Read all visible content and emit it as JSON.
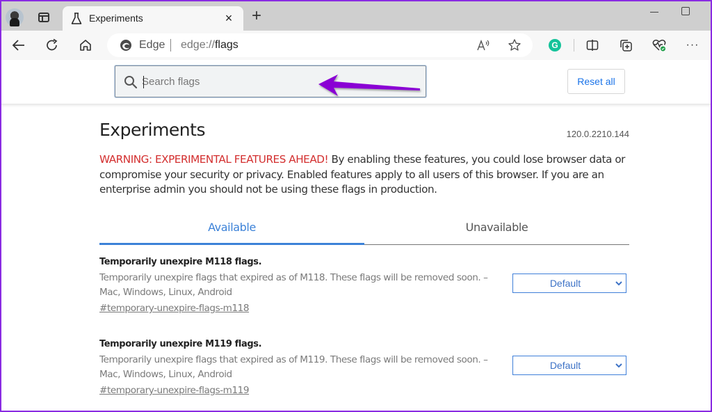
{
  "browser": {
    "tab": {
      "title": "Experiments",
      "icon": "flask-icon",
      "close_label": "×"
    },
    "new_tab_label": "+",
    "address_bar": {
      "brand": "Edge",
      "url_prefix": "edge://",
      "url_path": "flags"
    },
    "toolbar_icons": [
      "back-icon",
      "refresh-icon",
      "home-icon",
      "read-aloud-icon",
      "favorite-star-icon",
      "grammarly-icon",
      "split-screen-icon",
      "collections-icon",
      "browser-essentials-icon",
      "more-menu-icon"
    ],
    "grammarly_glyph": "G",
    "more_label": "···"
  },
  "flags_header": {
    "search": {
      "placeholder": "Search flags",
      "value": ""
    },
    "reset_label": "Reset all"
  },
  "page": {
    "title": "Experiments",
    "version": "120.0.2210.144",
    "warning_label": "WARNING: EXPERIMENTAL FEATURES AHEAD!",
    "warning_text": " By enabling these features, you could lose browser data or compromise your security or privacy. Enabled features apply to all users of this browser. If you are an enterprise admin you should not be using these flags in production.",
    "tabs": [
      {
        "label": "Available",
        "active": true
      },
      {
        "label": "Unavailable",
        "active": false
      }
    ],
    "flags": [
      {
        "name": "Temporarily unexpire M118 flags.",
        "description": "Temporarily unexpire flags that expired as of M118. These flags will be removed soon. – Mac, Windows, Linux, Android",
        "link": "#temporary-unexpire-flags-m118",
        "selected": "Default"
      },
      {
        "name": "Temporarily unexpire M119 flags.",
        "description": "Temporarily unexpire flags that expired as of M119. These flags will be removed soon. – Mac, Windows, Linux, Android",
        "link": "#temporary-unexpire-flags-m119",
        "selected": "Default"
      }
    ]
  },
  "colors": {
    "accent": "#3c82d8",
    "warning": "#d32f2f",
    "annotation_arrow": "#8a00d4",
    "window_border": "#8a2be2"
  }
}
